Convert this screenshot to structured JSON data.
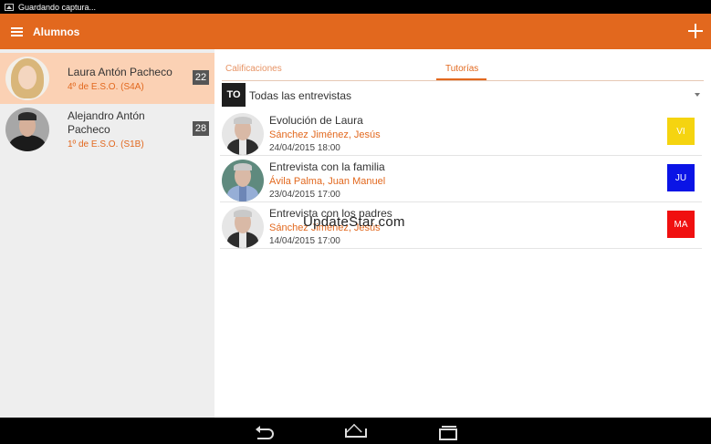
{
  "status_bar": {
    "notification": "Guardando captura..."
  },
  "app_bar": {
    "title": "Alumnos"
  },
  "students": [
    {
      "name": "Laura Antón Pacheco",
      "class": "4º de E.S.O. (S4A)",
      "count": "22",
      "selected": true
    },
    {
      "name": "Alejandro Antón Pacheco",
      "class": "1º de E.S.O. (S1B)",
      "count": "28",
      "selected": false
    }
  ],
  "tabs": [
    {
      "label": "Calificaciones",
      "active": false
    },
    {
      "label": "Tutorías",
      "active": true
    }
  ],
  "filter": {
    "badge": "TO",
    "label": "Todas las entrevistas"
  },
  "interviews": [
    {
      "title": "Evolución de Laura",
      "people": "Sánchez  Jiménez, Jesús",
      "date": "24/04/2015 18:00",
      "day": "VI",
      "day_color": "#f5d410",
      "day_text_color": "#ffffff"
    },
    {
      "title": "Entrevista con la familia",
      "people": "Ávila Palma, Juan Manuel",
      "date": "23/04/2015 17:00",
      "day": "JU",
      "day_color": "#0a14e6",
      "day_text_color": "#ffffff"
    },
    {
      "title": "Entrevista con los padres",
      "people": "Sánchez  Jiménez, Jesús",
      "date": "14/04/2015 17:00",
      "day": "MA",
      "day_color": "#f01010",
      "day_text_color": "#ffffff"
    }
  ],
  "watermark": "UpdateStar.com",
  "colors": {
    "accent": "#e2681e",
    "selected_row": "#fbd1b4"
  },
  "icons": {
    "menu": "hamburger-menu-icon",
    "add": "plus-icon",
    "back": "back-icon",
    "home": "home-icon",
    "recent": "recent-apps-icon"
  }
}
